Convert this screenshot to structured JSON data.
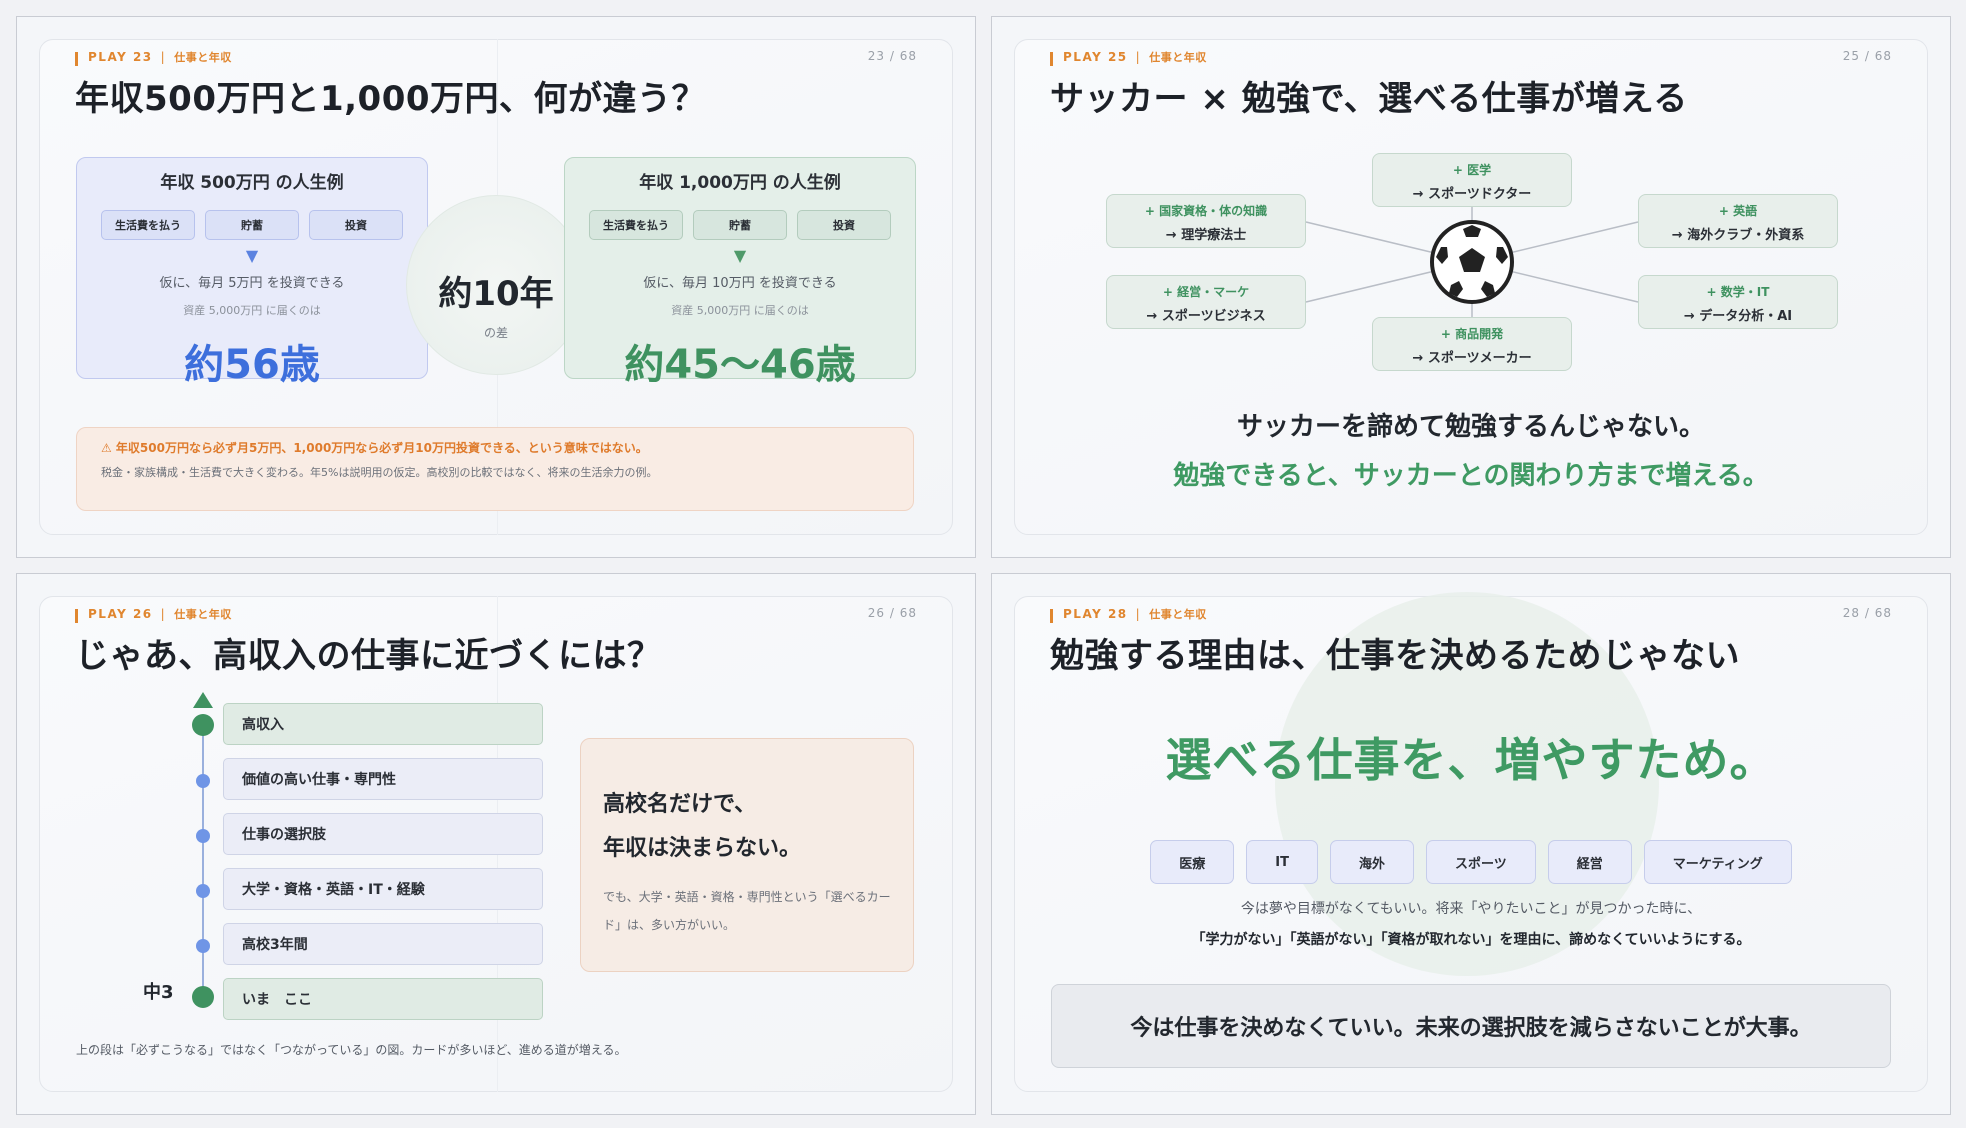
{
  "slides": [
    {
      "play": "PLAY 23",
      "category": "仕事と年収",
      "page": "23 / 68",
      "title": "年収500万円と1,000万円、何が違う？",
      "left": {
        "heading": "年収 500万円 の人生例",
        "pills": [
          "生活費を払う",
          "貯蓄",
          "投資"
        ],
        "line1": "仮に、毎月 5万円 を投資できる",
        "line2": "資産 5,000万円 に届くのは",
        "result": "約56歳"
      },
      "middle": {
        "value": "約10年",
        "caption": "の差"
      },
      "right": {
        "heading": "年収 1,000万円 の人生例",
        "pills": [
          "生活費を払う",
          "貯蓄",
          "投資"
        ],
        "line1": "仮に、毎月 10万円 を投資できる",
        "line2": "資産 5,000万円 に届くのは",
        "result": "約45〜46歳"
      },
      "warning": {
        "headline": "⚠ 年収500万円なら必ず月5万円、1,000万円なら必ず月10万円投資できる、という意味ではない。",
        "detail": "税金・家族構成・生活費で大きく変わる。年5%は説明用の仮定。高校別の比較ではなく、将来の生活余力の例。"
      }
    },
    {
      "play": "PLAY 25",
      "category": "仕事と年収",
      "page": "25 / 68",
      "title": "サッカー × 勉強で、選べる仕事が増える",
      "nodes": [
        {
          "plus": "+ 医学",
          "job": "→ スポーツドクター"
        },
        {
          "plus": "+ 国家資格・体の知識",
          "job": "→ 理学療法士"
        },
        {
          "plus": "+ 英語",
          "job": "→ 海外クラブ・外資系"
        },
        {
          "plus": "+ 経営・マーケ",
          "job": "→ スポーツビジネス"
        },
        {
          "plus": "+ 数学・IT",
          "job": "→ データ分析・AI"
        },
        {
          "plus": "+ 商品開発",
          "job": "→ スポーツメーカー"
        }
      ],
      "center_icon": "soccer-ball",
      "line1": "サッカーを諦めて勉強するんじゃない。",
      "line2": "勉強できると、サッカーとの関わり方まで増える。"
    },
    {
      "play": "PLAY 26",
      "category": "仕事と年収",
      "page": "26 / 68",
      "title": "じゃあ、高収入の仕事に近づくには？",
      "steps": [
        "高収入",
        "価値の高い仕事・専門性",
        "仕事の選択肢",
        "大学・資格・英語・IT・経験",
        "高校3年間",
        "いま　ここ"
      ],
      "grade_label": "中3",
      "note_title_1": "高校名だけで、",
      "note_title_2": "年収は決まらない。",
      "note_body": "でも、大学・英語・資格・専門性という「選べるカード」は、多い方がいい。",
      "footer": "上の段は「必ずこうなる」ではなく「つながっている」の図。カードが多いほど、進める道が増える。"
    },
    {
      "play": "PLAY 28",
      "category": "仕事と年収",
      "page": "28 / 68",
      "title": "勉強する理由は、仕事を決めるためじゃない",
      "headline": "選べる仕事を、増やすため。",
      "tags": [
        "医療",
        "IT",
        "海外",
        "スポーツ",
        "経営",
        "マーケティング"
      ],
      "text1": "今は夢や目標がなくてもいい。将来「やりたいこと」が見つかった時に、",
      "text2": "「学力がない」「英語がない」「資格が取れない」を理由に、諦めなくていいようにする。",
      "box": "今は仕事を決めなくていい。未来の選択肢を減らさないことが大事。"
    }
  ],
  "colors": {
    "accent_orange": "#e0862f",
    "green": "#3f9260",
    "blue": "#3d6fdc"
  }
}
